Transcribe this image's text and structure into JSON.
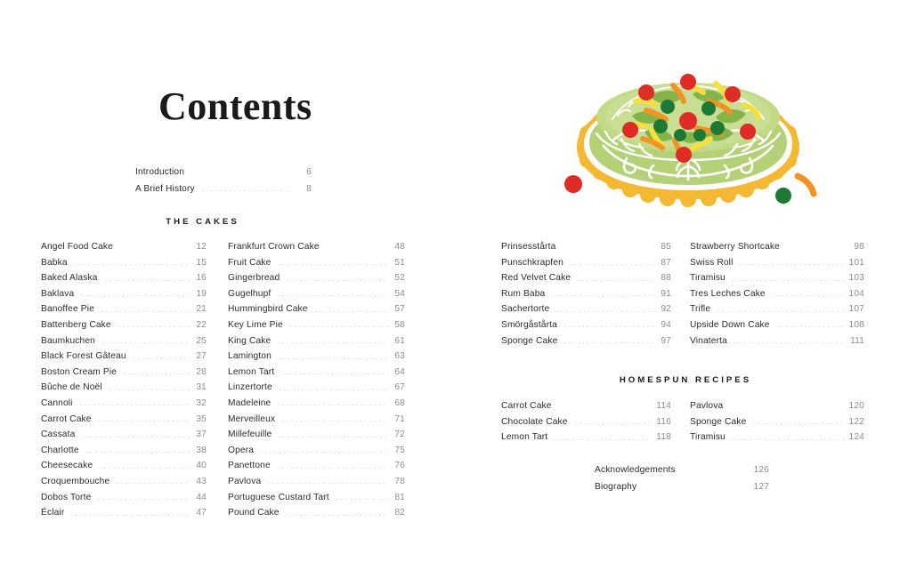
{
  "page": {
    "title": "Contents",
    "background_color": "#ffffff"
  },
  "frontmatter": {
    "rows": [
      {
        "label": "Introduction",
        "page": "6"
      },
      {
        "label": "A Brief History",
        "page": "8"
      }
    ]
  },
  "sections": {
    "cakes_heading": "THE CAKES",
    "homespun_heading": "HOMESPUN RECIPES"
  },
  "cakes": {
    "column_1": [
      {
        "label": "Angel Food Cake",
        "page": "12"
      },
      {
        "label": "Babka",
        "page": "15"
      },
      {
        "label": "Baked Alaska",
        "page": "16"
      },
      {
        "label": "Baklava",
        "page": "19"
      },
      {
        "label": "Banoffee Pie",
        "page": "21"
      },
      {
        "label": "Battenberg Cake",
        "page": "22"
      },
      {
        "label": "Baumkuchen",
        "page": "25"
      },
      {
        "label": "Black Forest Gâteau",
        "page": "27"
      },
      {
        "label": "Boston Cream Pie",
        "page": "28"
      },
      {
        "label": "Bûche de Noël",
        "page": "31"
      },
      {
        "label": "Cannoli",
        "page": "32"
      },
      {
        "label": "Carrot Cake",
        "page": "35"
      },
      {
        "label": "Cassata",
        "page": "37"
      },
      {
        "label": "Charlotte",
        "page": "38"
      },
      {
        "label": "Cheesecake",
        "page": "40"
      },
      {
        "label": "Croquembouche",
        "page": "43"
      },
      {
        "label": "Dobos Torte",
        "page": "44"
      },
      {
        "label": "Éclair",
        "page": "47"
      }
    ],
    "column_2": [
      {
        "label": "Frankfurt Crown Cake",
        "page": "48"
      },
      {
        "label": "Fruit Cake",
        "page": "51"
      },
      {
        "label": "Gingerbread",
        "page": "52"
      },
      {
        "label": "Gugelhupf",
        "page": "54"
      },
      {
        "label": "Hummingbird Cake",
        "page": "57"
      },
      {
        "label": "Key Lime Pie",
        "page": "58"
      },
      {
        "label": "King Cake",
        "page": "61"
      },
      {
        "label": "Lamington",
        "page": "63"
      },
      {
        "label": "Lemon Tart",
        "page": "64"
      },
      {
        "label": "Linzertorte",
        "page": "67"
      },
      {
        "label": "Madeleine",
        "page": "68"
      },
      {
        "label": "Merveilleux",
        "page": "71"
      },
      {
        "label": "Millefeuille",
        "page": "72"
      },
      {
        "label": "Opera",
        "page": "75"
      },
      {
        "label": "Panettone",
        "page": "76"
      },
      {
        "label": "Pavlova",
        "page": "78"
      },
      {
        "label": "Portuguese Custard Tart",
        "page": "81"
      },
      {
        "label": "Pound Cake",
        "page": "82"
      }
    ],
    "column_3": [
      {
        "label": "Prinsesstårta",
        "page": "85"
      },
      {
        "label": "Punschkrapfen",
        "page": "87"
      },
      {
        "label": "Red Velvet Cake",
        "page": "88"
      },
      {
        "label": "Rum Baba",
        "page": "91"
      },
      {
        "label": "Sachertorte",
        "page": "92"
      },
      {
        "label": "Smörgåstårta",
        "page": "94"
      },
      {
        "label": "Sponge Cake",
        "page": "97"
      }
    ],
    "column_4": [
      {
        "label": "Strawberry Shortcake",
        "page": "98"
      },
      {
        "label": "Swiss Roll",
        "page": "101"
      },
      {
        "label": "Tiramisu",
        "page": "103"
      },
      {
        "label": "Tres Leches Cake",
        "page": "104"
      },
      {
        "label": "Trifle",
        "page": "107"
      },
      {
        "label": "Upside Down Cake",
        "page": "108"
      },
      {
        "label": "Vinaterta",
        "page": "111"
      }
    ]
  },
  "homespun": {
    "column_1": [
      {
        "label": "Carrot Cake",
        "page": "114"
      },
      {
        "label": "Chocolate Cake",
        "page": "116"
      },
      {
        "label": "Lemon Tart",
        "page": "118"
      }
    ],
    "column_2": [
      {
        "label": "Pavlova",
        "page": "120"
      },
      {
        "label": "Sponge Cake",
        "page": "122"
      },
      {
        "label": "Tiramisu",
        "page": "124"
      }
    ]
  },
  "backmatter": {
    "rows": [
      {
        "label": "Acknowledgements",
        "page": "126"
      },
      {
        "label": "Biography",
        "page": "127"
      }
    ]
  },
  "illustration": {
    "name": "decorated-green-cake",
    "description": "Prinsesstårta style green marzipan cake on a scalloped golden plate, topped with red cherries, green marzipan leaves, dark green dots and yellow and orange candied peel curls",
    "colors": {
      "cake_green": "#b5d178",
      "cake_top_green": "#c8de92",
      "plate_gold": "#f5b833",
      "piping_white": "#ffffff",
      "cherry_red": "#e02c26",
      "leaf_green": "#86b347",
      "dot_green": "#1c7a35",
      "peel_yellow": "#f7e03d",
      "peel_orange": "#f39324"
    }
  }
}
